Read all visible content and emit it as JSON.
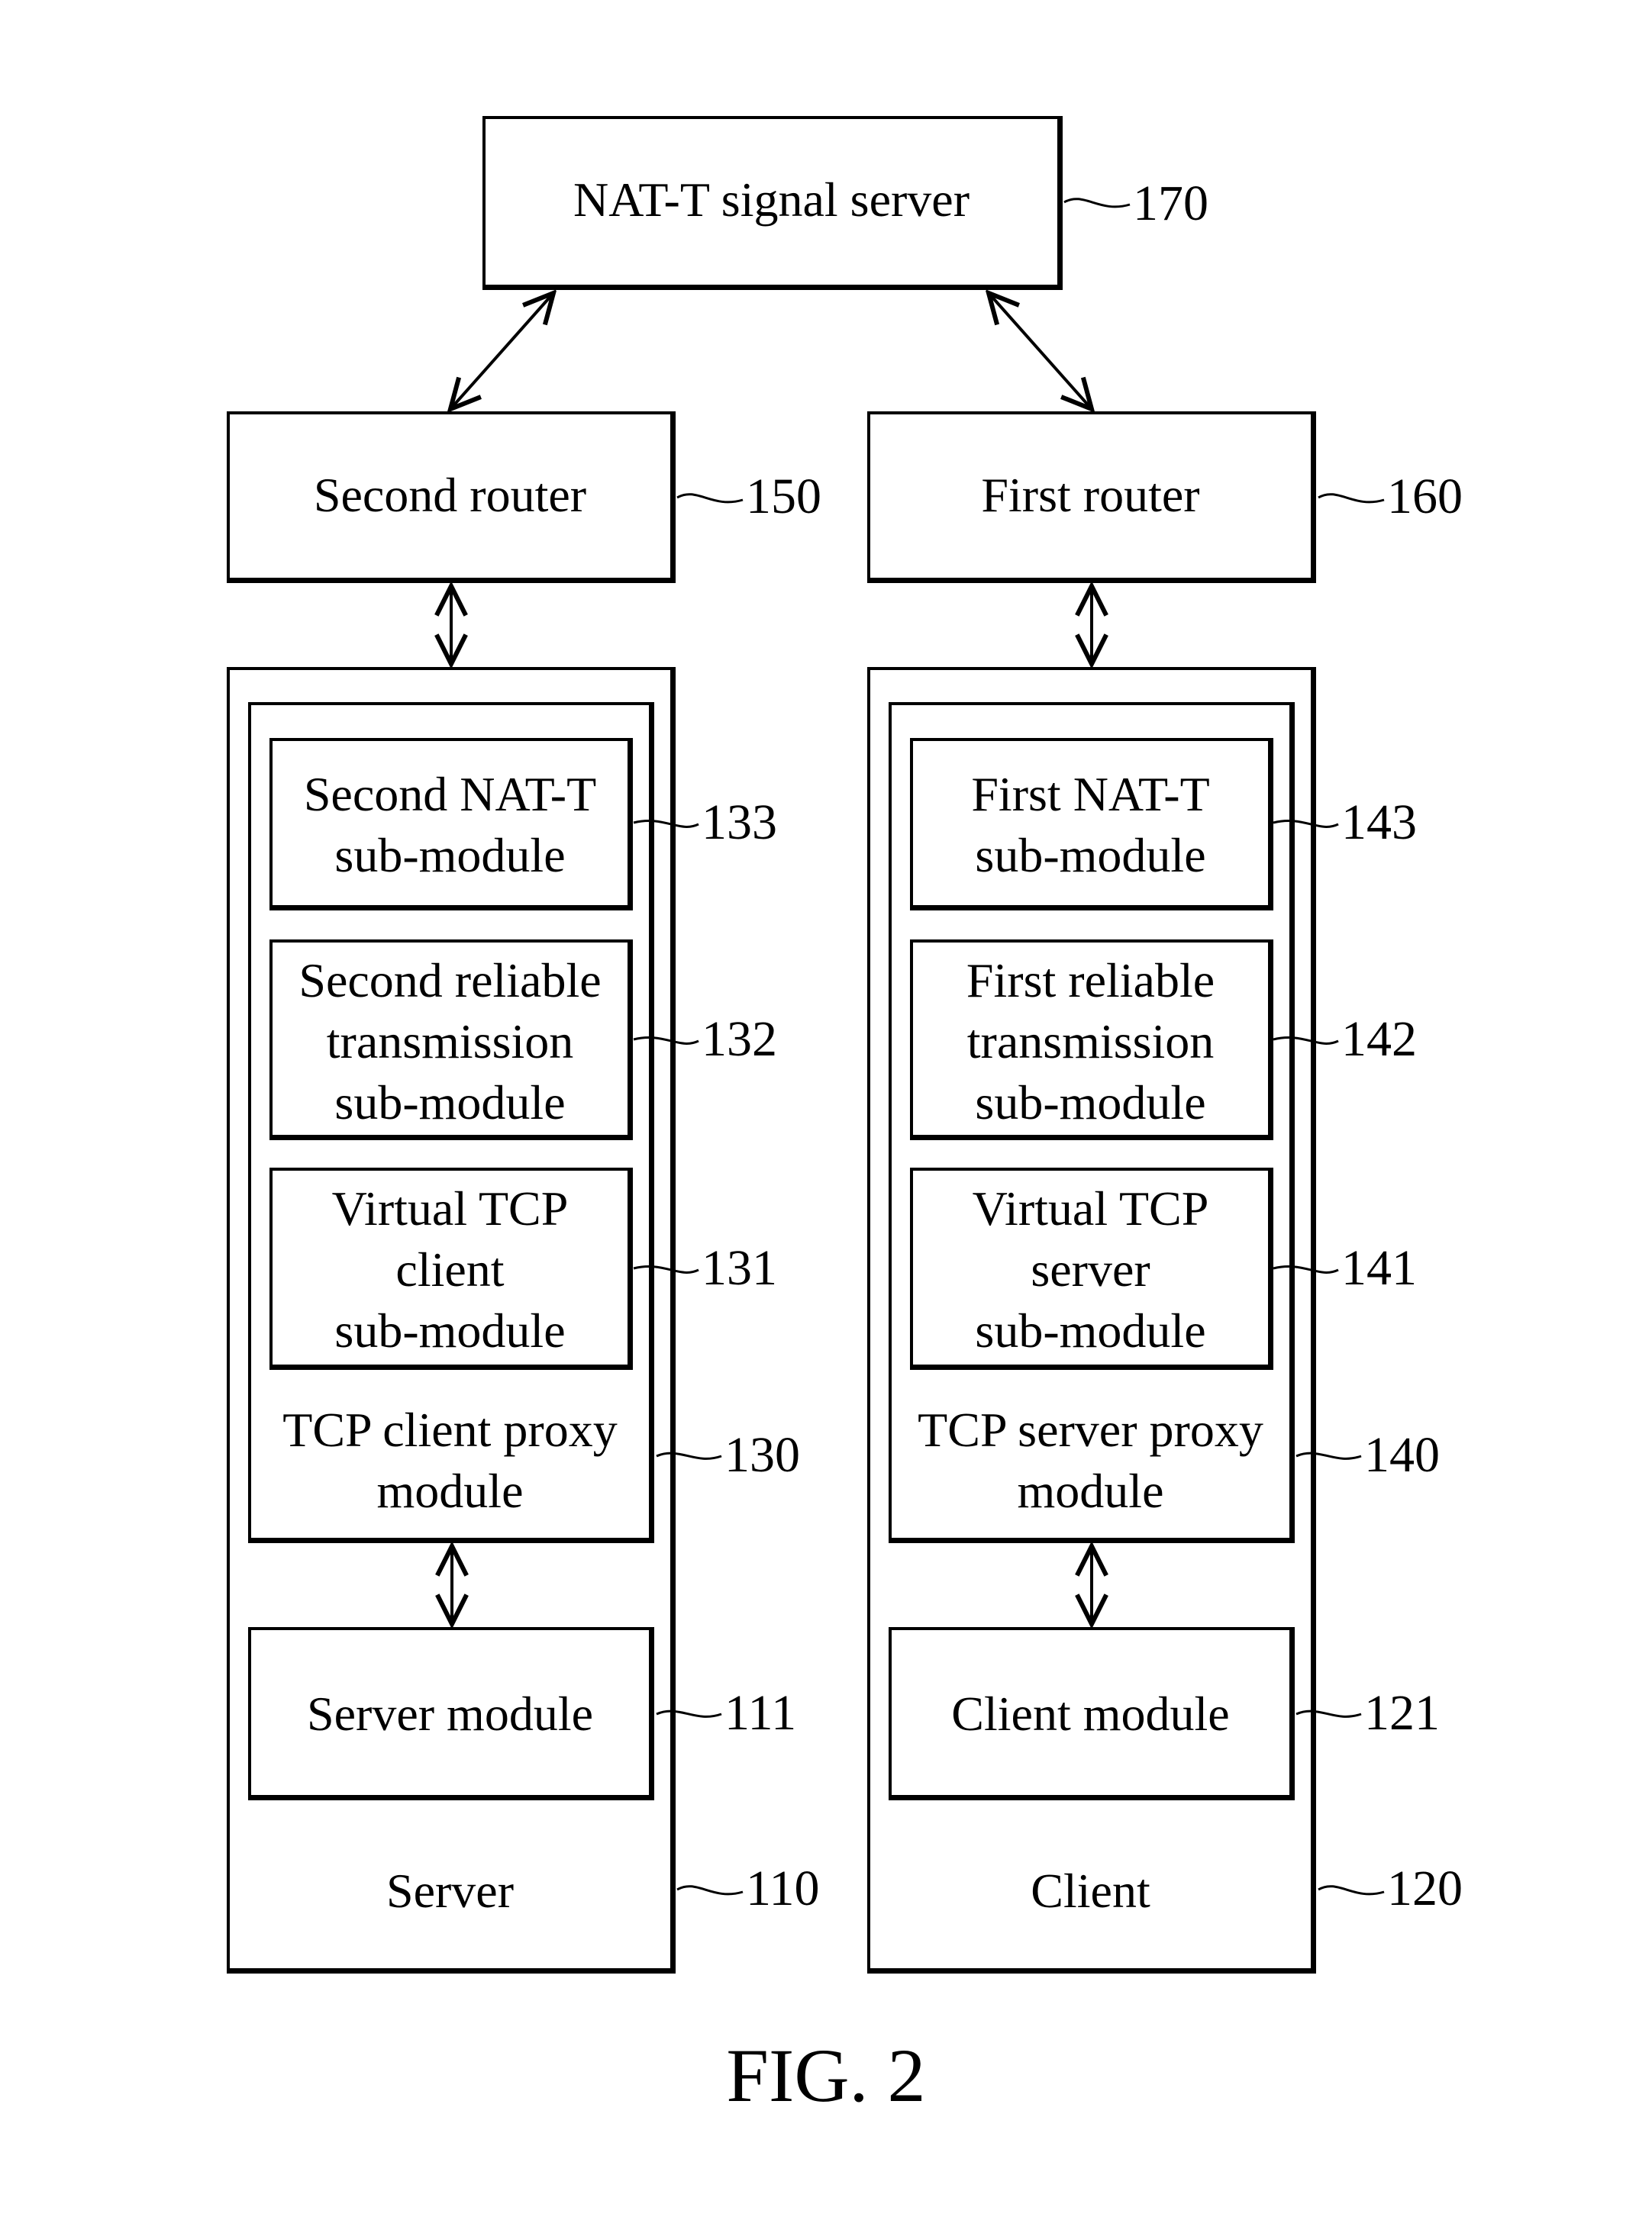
{
  "figure_caption": "FIG. 2",
  "nat_server": {
    "label": "NAT-T signal server",
    "ref": "170"
  },
  "second_router": {
    "label": "Second router",
    "ref": "150"
  },
  "first_router": {
    "label": "First router",
    "ref": "160"
  },
  "server": {
    "label": "Server",
    "ref": "110",
    "proxy": {
      "label": "TCP client proxy\nmodule",
      "ref": "130",
      "submodules": [
        {
          "label": "Second NAT-T\nsub-module",
          "ref": "133"
        },
        {
          "label": "Second reliable\ntransmission\nsub-module",
          "ref": "132"
        },
        {
          "label": "Virtual TCP\nclient\nsub-module",
          "ref": "131"
        }
      ]
    },
    "module": {
      "label": "Server module",
      "ref": "111"
    }
  },
  "client": {
    "label": "Client",
    "ref": "120",
    "proxy": {
      "label": "TCP server proxy\nmodule",
      "ref": "140",
      "submodules": [
        {
          "label": "First NAT-T\nsub-module",
          "ref": "143"
        },
        {
          "label": "First reliable\ntransmission\nsub-module",
          "ref": "142"
        },
        {
          "label": "Virtual TCP\nserver\nsub-module",
          "ref": "141"
        }
      ]
    },
    "module": {
      "label": "Client module",
      "ref": "121"
    }
  }
}
